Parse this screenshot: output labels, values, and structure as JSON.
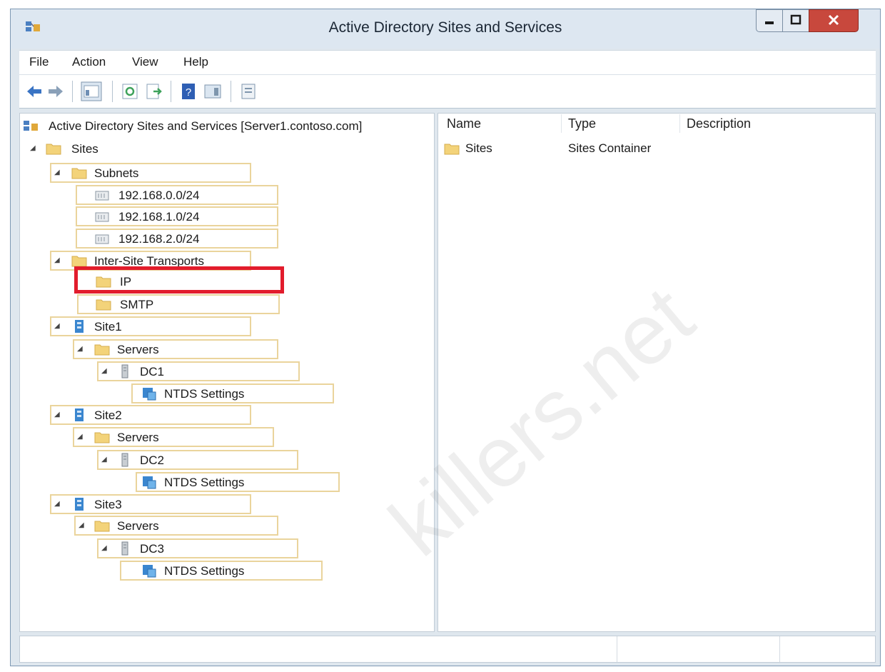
{
  "window": {
    "title": "Active Directory Sites and Services",
    "icon": "ad-sites-services-icon"
  },
  "menu": [
    "File",
    "Action",
    "View",
    "Help"
  ],
  "toolbar": {
    "buttons": [
      "back-arrow-icon",
      "forward-arrow-icon",
      "show-hide-tree-icon",
      "refresh-icon",
      "export-list-icon",
      "help-icon",
      "show-action-pane-icon",
      "properties-icon"
    ]
  },
  "tree": {
    "root": "Active Directory Sites and Services [Server1.contoso.com]",
    "sites": "Sites",
    "subnets": "Subnets",
    "subnet_items": [
      "192.168.0.0/24",
      "192.168.1.0/24",
      "192.168.2.0/24"
    ],
    "transports": "Inter-Site Transports",
    "transport_items": [
      "IP",
      "SMTP"
    ],
    "site1": "Site1",
    "site1_servers": "Servers",
    "site1_dc": "DC1",
    "site1_ntds": "NTDS Settings",
    "site2": "Site2",
    "site2_servers": "Servers",
    "site2_dc": "DC2",
    "site2_ntds": "NTDS Settings",
    "site3": "Site3",
    "site3_servers": "Servers",
    "site3_dc": "DC3",
    "site3_ntds": "NTDS Settings"
  },
  "list": {
    "columns": [
      "Name",
      "Type",
      "Description"
    ],
    "rows": [
      {
        "name": "Sites",
        "type": "Sites Container",
        "description": ""
      }
    ]
  },
  "watermark": "killers.net",
  "colors": {
    "highlight": "#e21c2c",
    "folder": "#f3d37a",
    "titlebar": "#dde7f1"
  }
}
